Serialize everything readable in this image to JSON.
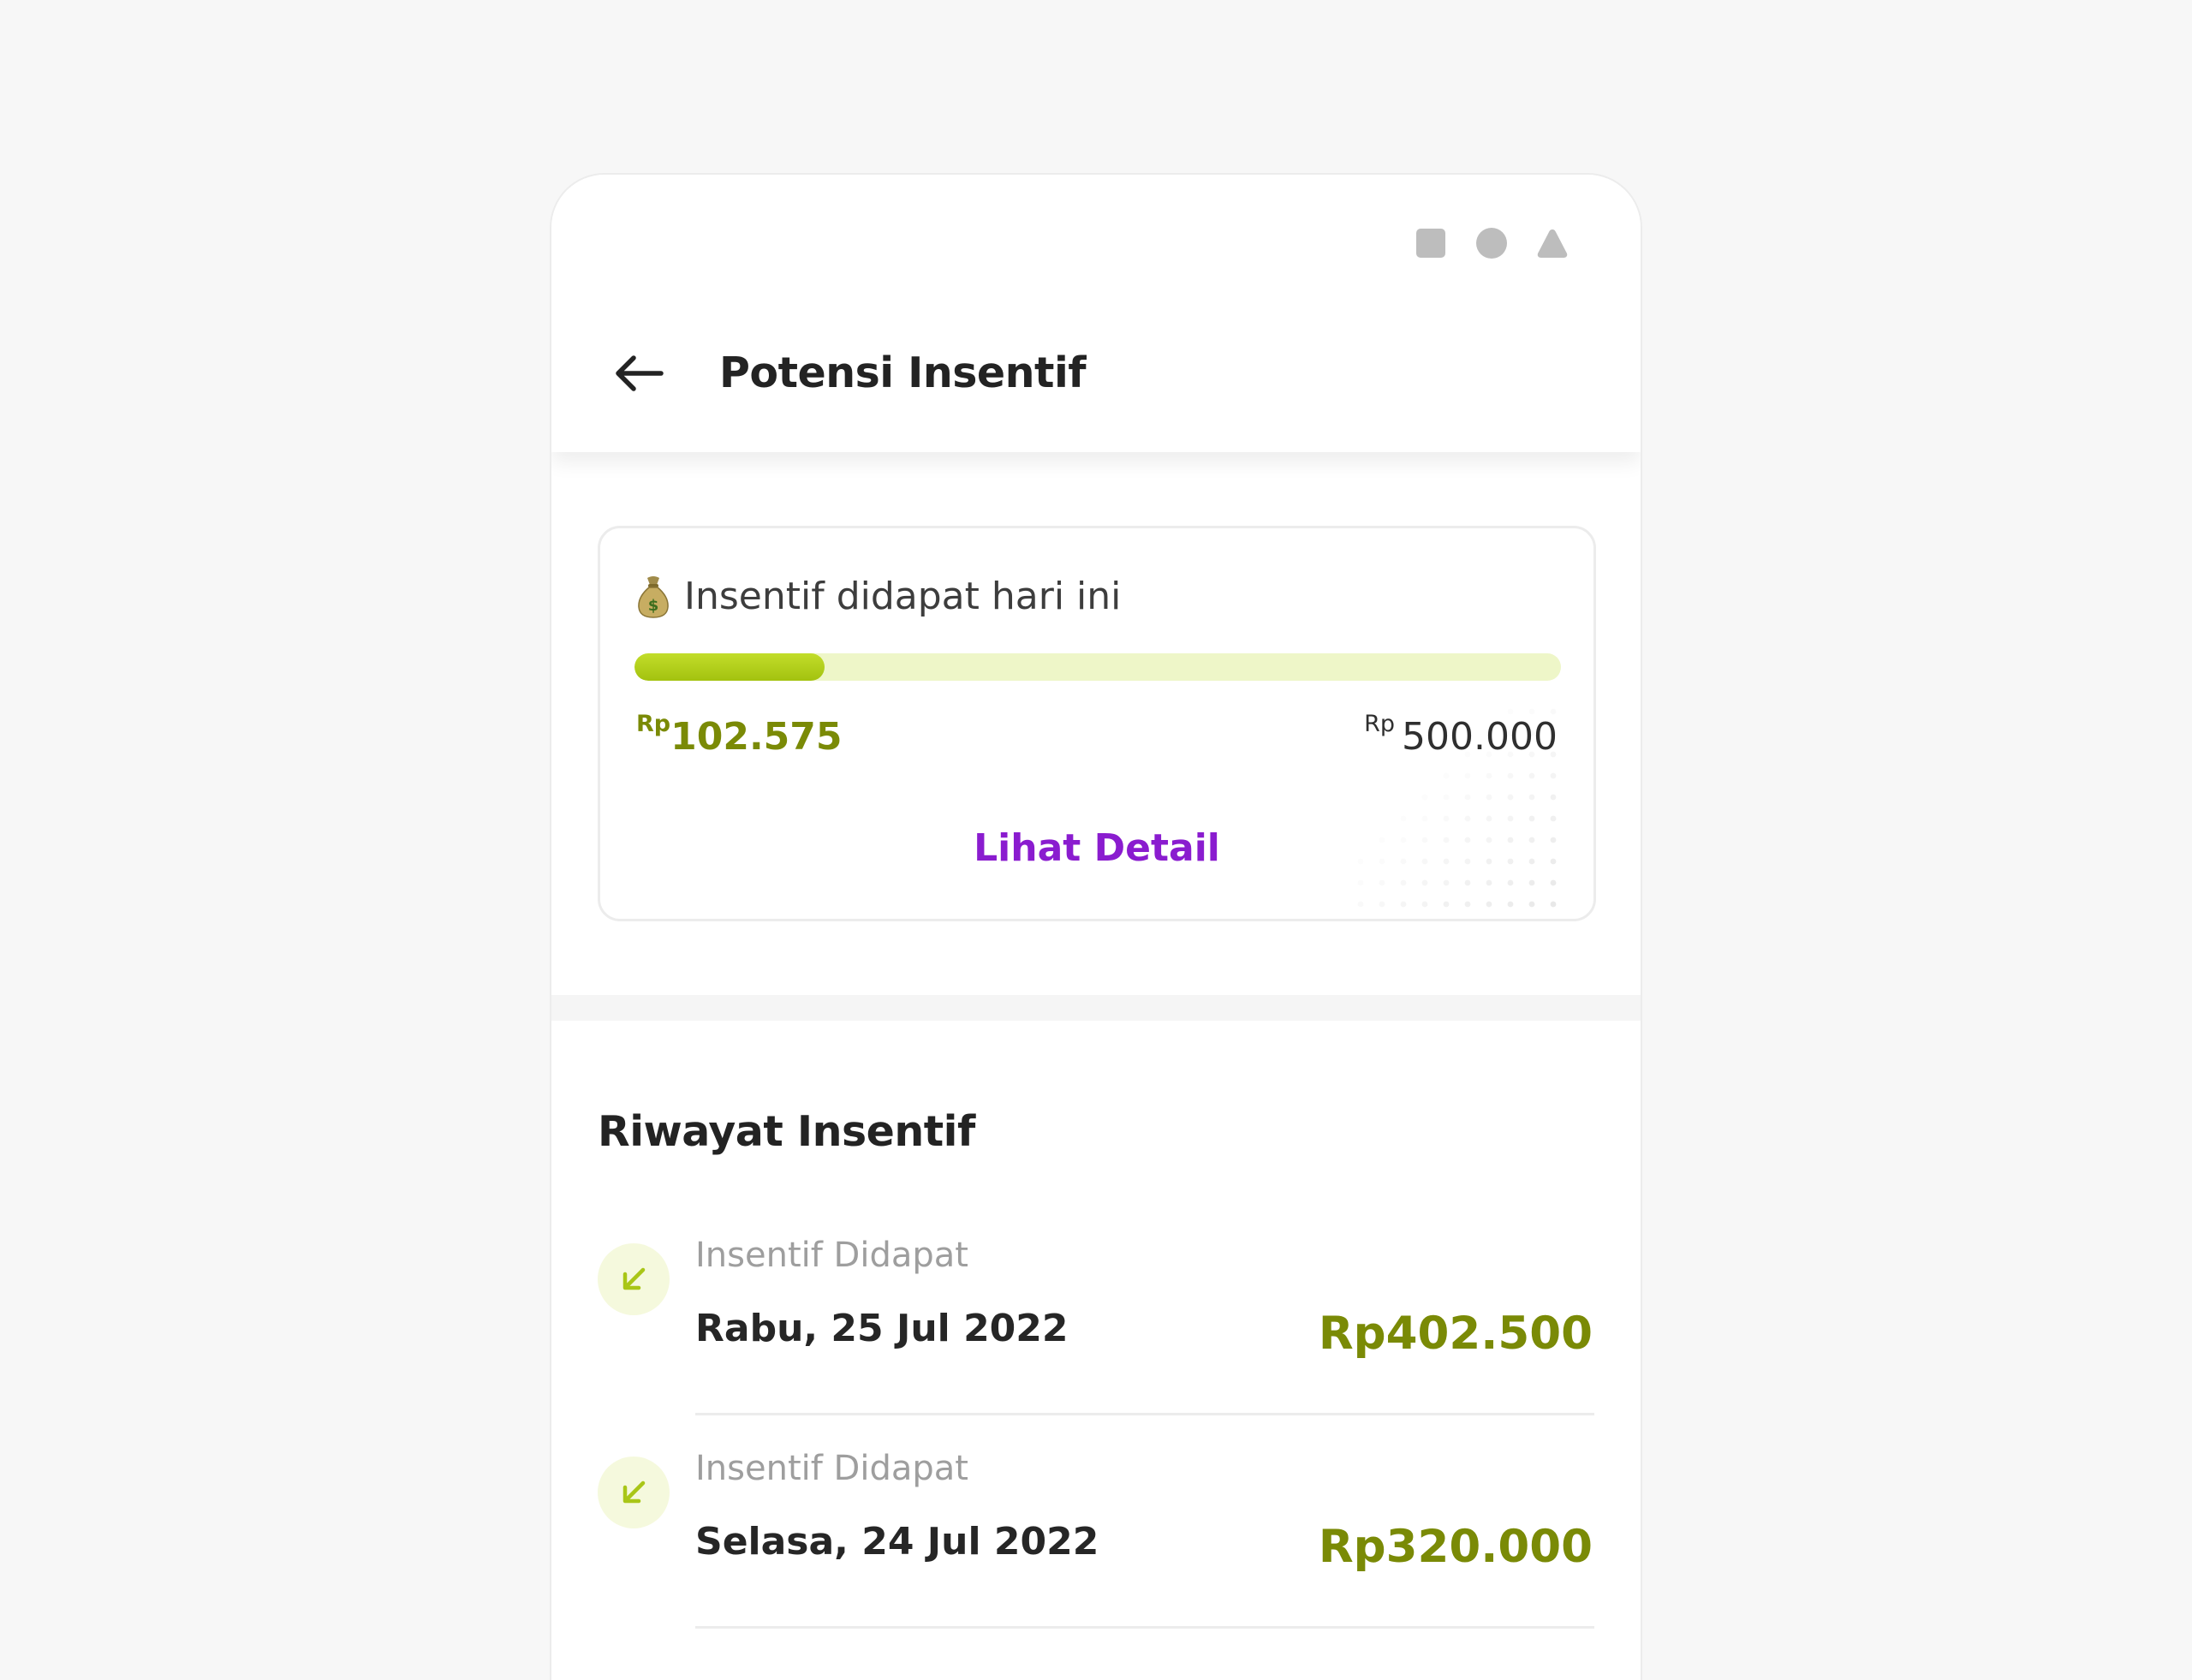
{
  "header": {
    "title": "Potensi Insentif"
  },
  "today_card": {
    "icon": "money-bag-icon",
    "title": "Insentif didapat hari ini",
    "currency_label": "Rp",
    "current_amount": "102.575",
    "target_amount": "500.000",
    "progress_fraction": 0.205,
    "detail_label": "Lihat Detail"
  },
  "history": {
    "title": "Riwayat Insentif",
    "items": [
      {
        "label": "Insentif Didapat",
        "date": "Rabu, 25 Jul 2022",
        "amount": "Rp402.500"
      },
      {
        "label": "Insentif Didapat",
        "date": "Selasa, 24 Jul 2022",
        "amount": "Rp320.000"
      }
    ]
  },
  "colors": {
    "accent_green": "#7a8a06",
    "progress_fill": "#a8c712",
    "progress_track": "#eef6c8",
    "link_purple": "#8a1ccf",
    "icon_bg": "#f5f9dd"
  }
}
